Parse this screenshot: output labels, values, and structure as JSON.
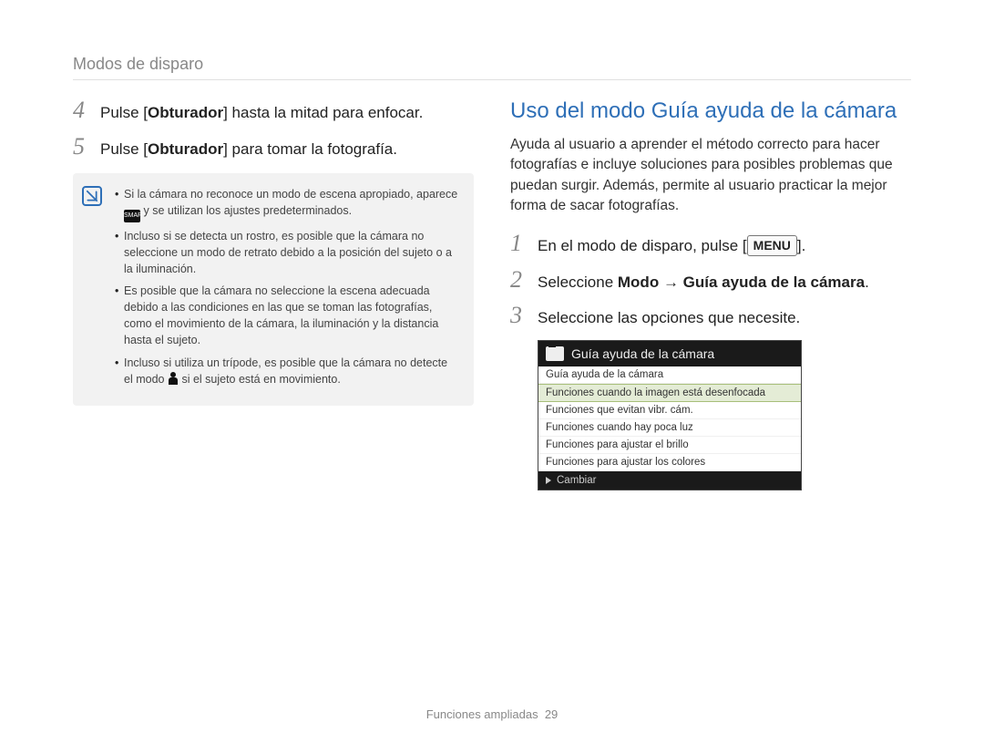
{
  "breadcrumb": "Modos de disparo",
  "left": {
    "step4_num": "4",
    "step4_pre": "Pulse [",
    "step4_bold": "Obturador",
    "step4_post": "] hasta la mitad para enfocar.",
    "step5_num": "5",
    "step5_pre": "Pulse [",
    "step5_bold": "Obturador",
    "step5_post": "] para tomar la fotografía.",
    "note_b1a": "Si la cámara no reconoce un modo de escena apropiado, aparece ",
    "note_b1b": " y se utilizan los ajustes predeterminados.",
    "note_b2": "Incluso si se detecta un rostro, es posible que la cámara no seleccione un modo de retrato debido a la posición del sujeto o a la iluminación.",
    "note_b3": "Es posible que la cámara no seleccione la escena adecuada debido a las condiciones en las que se toman las fotografías, como el movimiento de la cámara, la iluminación y la distancia hasta el sujeto.",
    "note_b4a": "Incluso si utiliza un trípode, es posible que la cámara no detecte el modo ",
    "note_b4b": " si el sujeto está en movimiento."
  },
  "right": {
    "heading": "Uso del modo Guía ayuda de la cámara",
    "intro": "Ayuda al usuario a aprender el método correcto para hacer fotografías e incluye soluciones para posibles problemas que puedan surgir. Además, permite al usuario practicar la mejor forma de sacar fotografías.",
    "step1_num": "1",
    "step1_pre": "En el modo de disparo, pulse [",
    "step1_btn": "MENU",
    "step1_post": "].",
    "step2_num": "2",
    "step2_pre": "Seleccione ",
    "step2_b1": "Modo",
    "step2_arrow": " → ",
    "step2_b2": "Guía ayuda de la cámara",
    "step2_post": ".",
    "step3_num": "3",
    "step3_text": "Seleccione las opciones que necesite.",
    "ui_title": "Guía ayuda de la cámara",
    "ui_items": [
      "Guía ayuda de la cámara",
      "Funciones cuando la imagen está desenfocada",
      "Funciones que evitan vibr. cám.",
      "Funciones cuando hay poca luz",
      "Funciones para ajustar el brillo",
      "Funciones para ajustar los colores"
    ],
    "ui_footer": "Cambiar"
  },
  "footer_label": "Funciones ampliadas",
  "footer_page": "29"
}
